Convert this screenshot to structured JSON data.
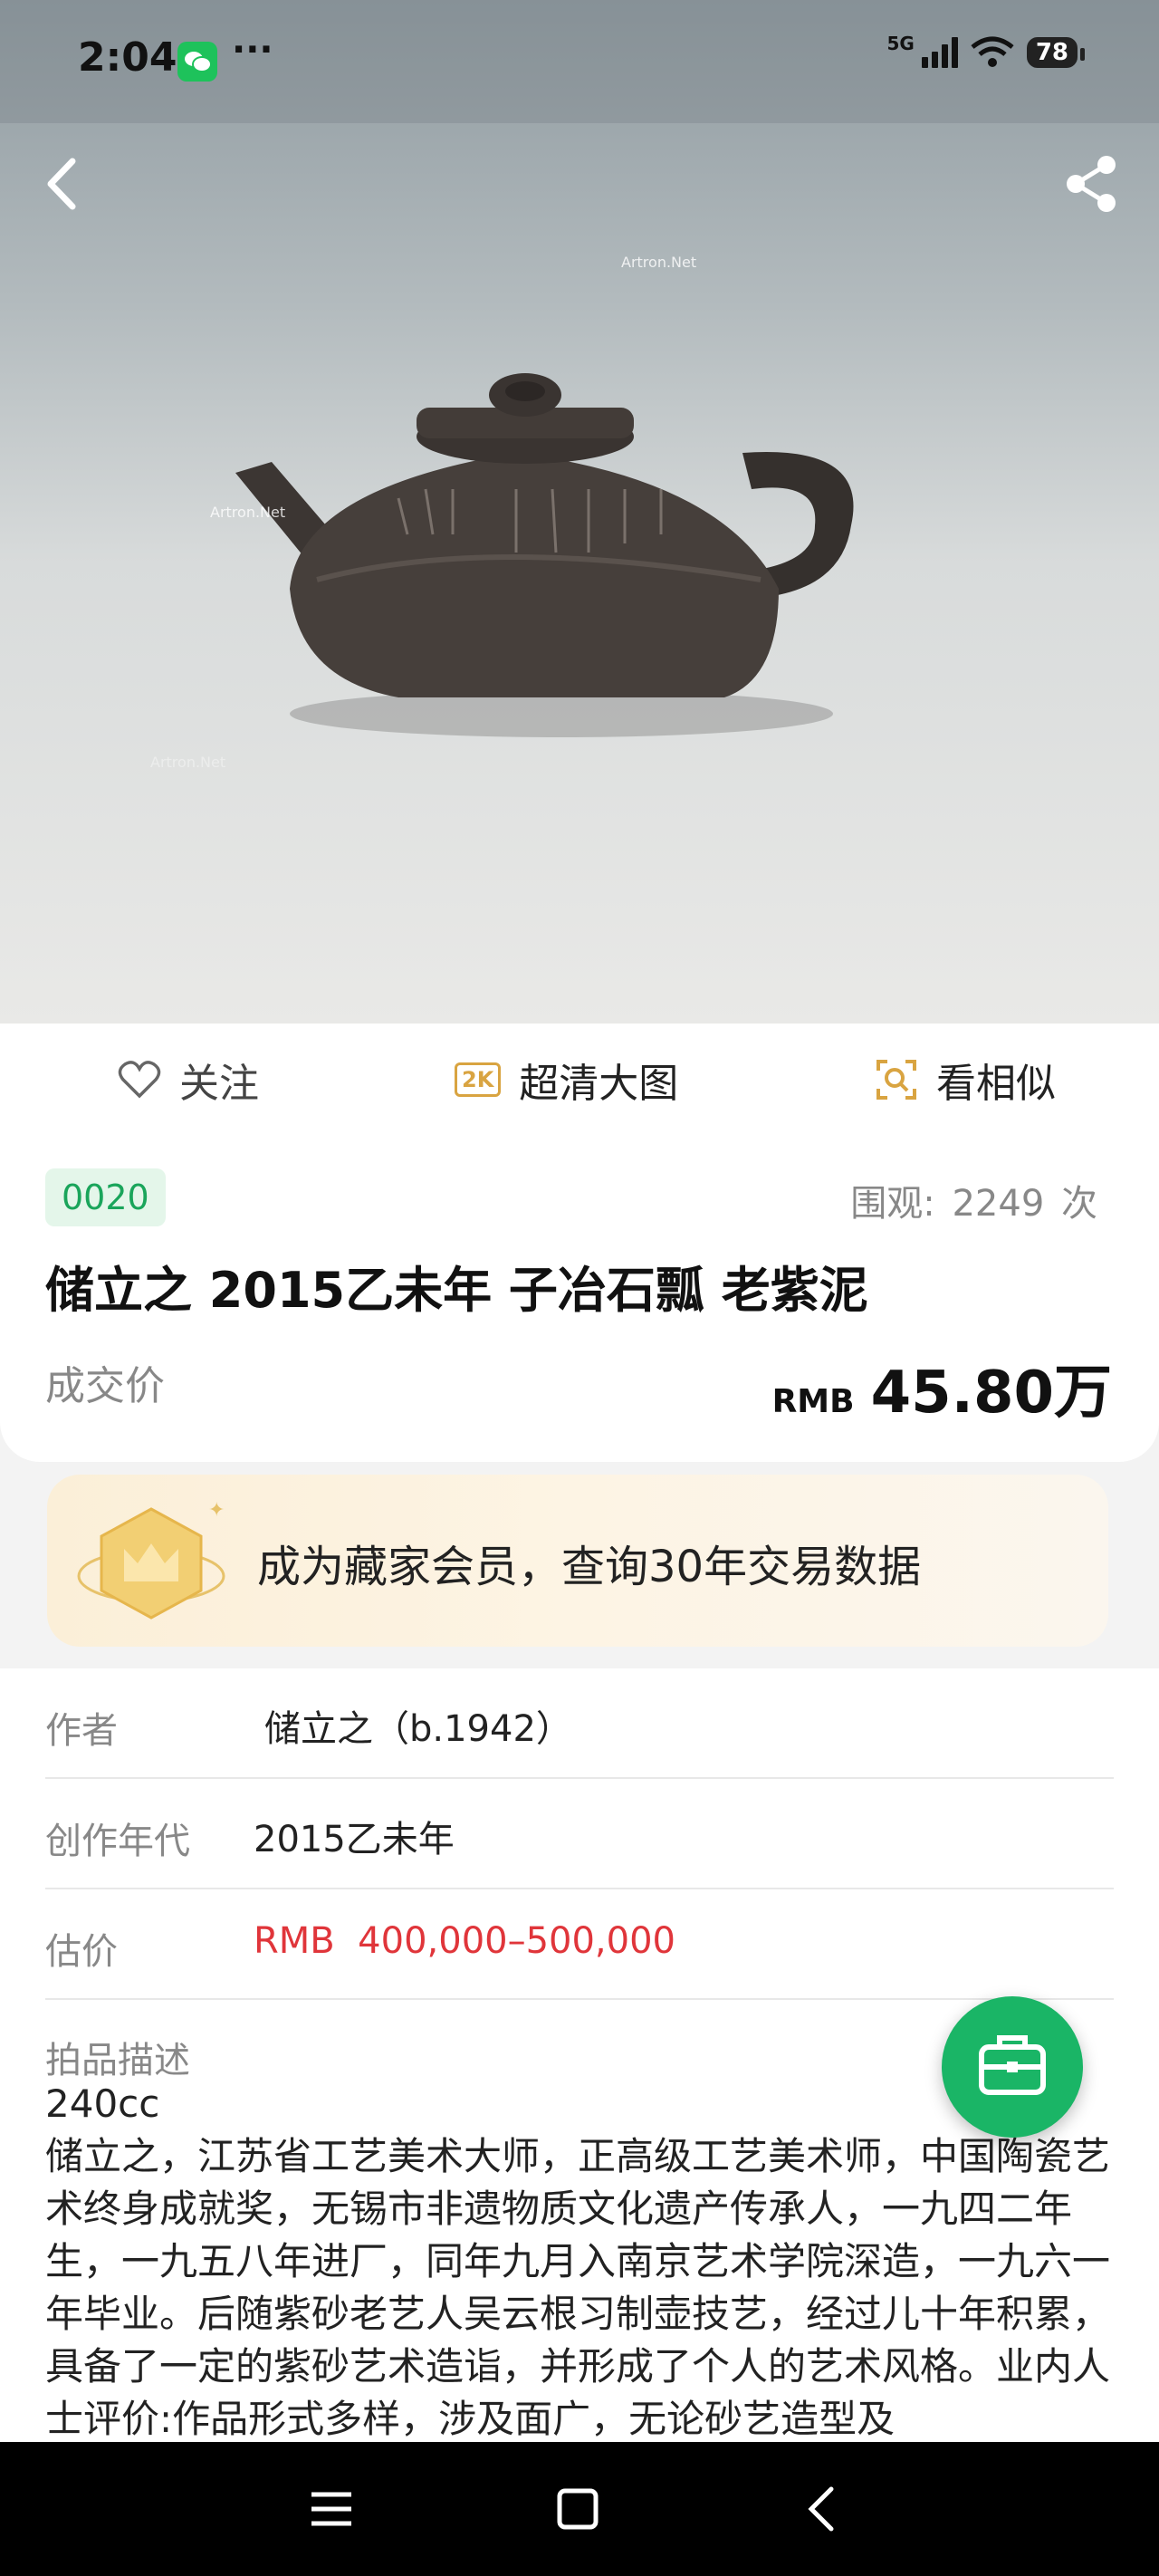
{
  "status_bar": {
    "time": "2:04",
    "more": "···",
    "network": "5G",
    "battery": "78"
  },
  "hero": {
    "watermarks": [
      "Artron.Net",
      "Artron.Net",
      "Artron.Net"
    ]
  },
  "actions": {
    "follow_label": "关注",
    "hd_label": "超清大图",
    "hd_icon_text": "2K",
    "similar_label": "看相似"
  },
  "lot": {
    "number": "0020",
    "views_label": "围观:",
    "views_count": "2249",
    "views_unit": "次",
    "title": "储立之 2015乙未年 子冶石瓢 老紫泥",
    "price_label": "成交价",
    "price_currency": "RMB",
    "price_amount": "45.80万"
  },
  "member_banner": {
    "text": "成为藏家会员，查询30年交易数据"
  },
  "details": {
    "rows": [
      {
        "key": "作者",
        "value": "储立之（b.1942）"
      },
      {
        "key": "创作年代",
        "value": "2015乙未年"
      },
      {
        "key": "估价",
        "value": "RMB  400,000–500,000"
      }
    ],
    "description_label": "拍品描述",
    "description_size": "240cc",
    "description_text": "储立之，江苏省工艺美术大师，正高级工艺美术师，中国陶瓷艺术终身成就奖，无锡市非遗物质文化遗产传承人，一九四二年生，一九五八年进厂，同年九月入南京艺术学院深造，一九六一年毕业。后随紫砂老艺人吴云根习制壶技艺，经过儿十年积累，具备了一定的紫砂艺术造诣，并形成了个人的艺术风格。业内人士评价:作品形式多样，涉及面广，无论砂艺造型及"
  },
  "colors": {
    "accent_green": "#1ab566",
    "price_red": "#e0353a",
    "gold": "#d9a441"
  }
}
